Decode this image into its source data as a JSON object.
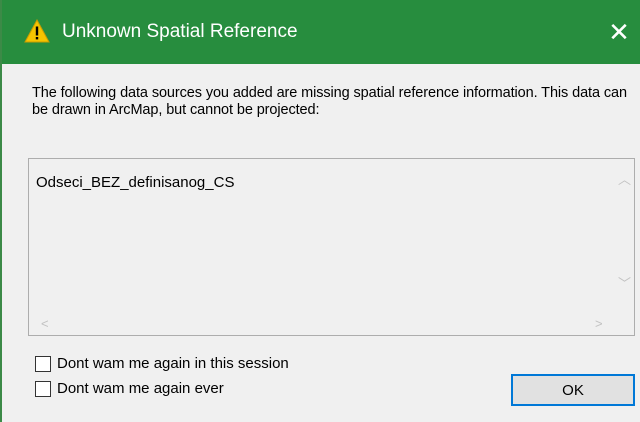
{
  "dialog": {
    "title": "Unknown Spatial Reference",
    "title_icon": "warning-icon",
    "close_glyph": "✕",
    "message": "The following data sources you added are missing spatial reference information. This data can be drawn in ArcMap, but cannot be projected:",
    "list_items": [
      "Odseci_BEZ_definisanog_CS"
    ],
    "checkboxes": [
      {
        "label": "Dont wam me again in this session",
        "checked": false
      },
      {
        "label": "Dont wam me again ever",
        "checked": false
      }
    ],
    "ok_label": "OK"
  },
  "colors": {
    "titlebar": "#278d3e",
    "focus_border": "#0078d7",
    "warning": "#f5c400"
  }
}
